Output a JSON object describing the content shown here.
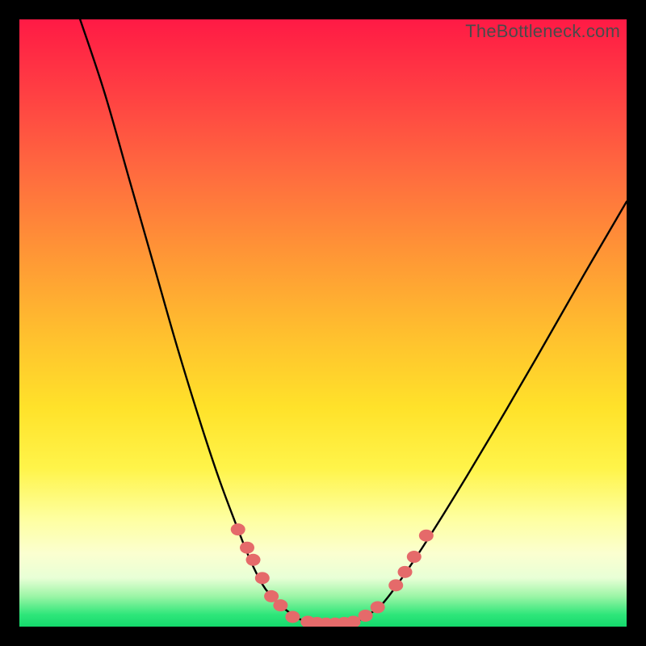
{
  "watermark": "TheBottleneck.com",
  "chart_data": {
    "type": "line",
    "title": "",
    "xlabel": "",
    "ylabel": "",
    "xlim": [
      0,
      100
    ],
    "ylim": [
      0,
      100
    ],
    "series": [
      {
        "name": "left-curve",
        "x": [
          10,
          14,
          18,
          22,
          26,
          30,
          33,
          36,
          38,
          40,
          41.5,
          43,
          44.5,
          46,
          47.5
        ],
        "y": [
          100,
          88,
          74,
          60,
          46,
          33,
          24,
          16,
          11,
          7,
          5,
          3.5,
          2.3,
          1.3,
          0.8
        ]
      },
      {
        "name": "valley-floor",
        "x": [
          47.5,
          49,
          50.5,
          52,
          53.5,
          55
        ],
        "y": [
          0.8,
          0.6,
          0.5,
          0.5,
          0.6,
          0.8
        ]
      },
      {
        "name": "right-curve",
        "x": [
          55,
          56.5,
          58,
          60,
          63,
          67,
          72,
          78,
          85,
          93,
          100
        ],
        "y": [
          0.8,
          1.3,
          2.3,
          4,
          8,
          14,
          22,
          32,
          44,
          58,
          70
        ]
      }
    ],
    "markers": [
      {
        "x": 36,
        "y": 16
      },
      {
        "x": 37.5,
        "y": 13
      },
      {
        "x": 38.5,
        "y": 11
      },
      {
        "x": 40,
        "y": 8
      },
      {
        "x": 41.5,
        "y": 5
      },
      {
        "x": 43,
        "y": 3.5
      },
      {
        "x": 45,
        "y": 1.6
      },
      {
        "x": 47.5,
        "y": 0.8
      },
      {
        "x": 49,
        "y": 0.6
      },
      {
        "x": 50.5,
        "y": 0.5
      },
      {
        "x": 52,
        "y": 0.5
      },
      {
        "x": 53.5,
        "y": 0.6
      },
      {
        "x": 55,
        "y": 0.8
      },
      {
        "x": 57,
        "y": 1.8
      },
      {
        "x": 59,
        "y": 3.2
      },
      {
        "x": 62,
        "y": 6.8
      },
      {
        "x": 63.5,
        "y": 9
      },
      {
        "x": 65,
        "y": 11.5
      },
      {
        "x": 67,
        "y": 15
      }
    ],
    "colors": {
      "curve": "#000000",
      "marker": "#e56a6a"
    }
  }
}
